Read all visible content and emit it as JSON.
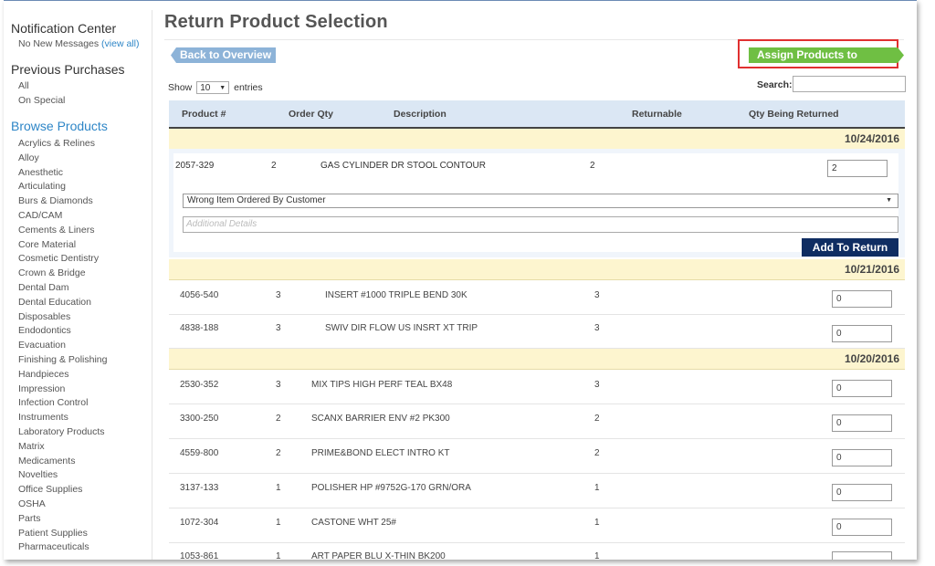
{
  "sidebar": {
    "notification": {
      "title": "Notification Center",
      "message": "No New Messages",
      "view_all": "(view all)"
    },
    "previous": {
      "title": "Previous Purchases",
      "items": [
        "All",
        "On Special"
      ]
    },
    "browse": {
      "title": "Browse Products",
      "categories": [
        "Acrylics & Relines",
        "Alloy",
        "Anesthetic",
        "Articulating",
        "Burs & Diamonds",
        "CAD/CAM",
        "Cements & Liners",
        "Core Material",
        "Cosmetic Dentistry",
        "Crown & Bridge",
        "Dental Dam",
        "Dental Education",
        "Disposables",
        "Endodontics",
        "Evacuation",
        "Finishing & Polishing",
        "Handpieces",
        "Impression",
        "Infection Control",
        "Instruments",
        "Laboratory Products",
        "Matrix",
        "Medicaments",
        "Novelties",
        "Office Supplies",
        "OSHA",
        "Parts",
        "Patient Supplies",
        "Pharmaceuticals"
      ]
    }
  },
  "main": {
    "title": "Return Product Selection",
    "back_label": "Back to Overview",
    "assign_label": "Assign Products to Boxes",
    "show_label": "Show",
    "entries_value": "10",
    "entries_label": "entries",
    "search_label": "Search:",
    "columns": [
      "Product #",
      "Order Qty",
      "Description",
      "Returnable",
      "Qty Being Returned"
    ],
    "groups": [
      {
        "date": "10/24/2016"
      },
      {
        "date": "10/21/2016"
      },
      {
        "date": "10/20/2016"
      }
    ],
    "rows": [
      {
        "product": "2057-329",
        "order_qty": "2",
        "description": "GAS CYLINDER DR STOOL CONTOUR",
        "returnable": "2",
        "qty_returned": "2"
      },
      {
        "product": "4056-540",
        "order_qty": "3",
        "description": "INSERT #1000 TRIPLE BEND 30K",
        "returnable": "3",
        "qty_returned": "0"
      },
      {
        "product": "4838-188",
        "order_qty": "3",
        "description": "SWIV DIR FLOW US INSRT XT TRIP",
        "returnable": "3",
        "qty_returned": "0"
      },
      {
        "product": "2530-352",
        "order_qty": "3",
        "description": "MIX TIPS HIGH PERF TEAL BX48",
        "returnable": "3",
        "qty_returned": "0"
      },
      {
        "product": "3300-250",
        "order_qty": "2",
        "description": "SCANX BARRIER ENV #2 PK300",
        "returnable": "2",
        "qty_returned": "0"
      },
      {
        "product": "4559-800",
        "order_qty": "2",
        "description": "PRIME&BOND ELECT INTRO KT",
        "returnable": "2",
        "qty_returned": "0"
      },
      {
        "product": "3137-133",
        "order_qty": "1",
        "description": "POLISHER HP #9752G-170 GRN/ORA",
        "returnable": "1",
        "qty_returned": "0"
      },
      {
        "product": "1072-304",
        "order_qty": "1",
        "description": "CASTONE WHT 25#",
        "returnable": "1",
        "qty_returned": "0"
      },
      {
        "product": "1053-861",
        "order_qty": "1",
        "description": "ART PAPER BLU X-THIN BK200",
        "returnable": "1",
        "qty_returned": ""
      }
    ],
    "expanded": {
      "reason_selected": "Wrong Item Ordered By Customer",
      "details_placeholder": "Additional Details",
      "add_label": "Add To Return"
    }
  }
}
